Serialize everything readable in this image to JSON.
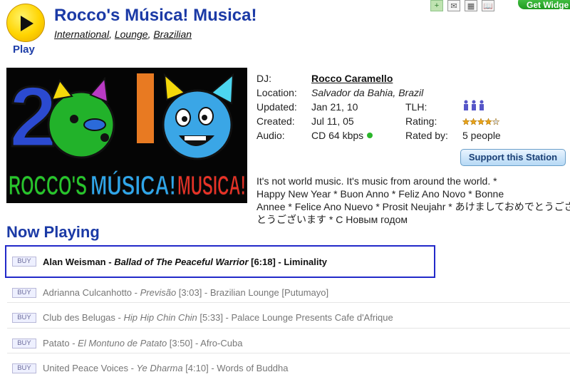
{
  "play": {
    "label": "Play"
  },
  "header": {
    "title": "Rocco's Música! Musica!",
    "genres": [
      "International",
      "Lounge",
      "Brazilian"
    ]
  },
  "toolbar": {
    "get_widget": "Get Widge"
  },
  "artwork": {
    "year_text": "2010",
    "caption_parts": [
      "ROCCO'S",
      "MÚSICA!",
      "MUSICA!"
    ]
  },
  "info": {
    "dj_label": "DJ:",
    "dj": "Rocco Caramello",
    "location_label": "Location:",
    "location": "Salvador da Bahia, Brazil",
    "updated_label": "Updated:",
    "updated": "Jan 21, 10",
    "tlh_label": "TLH:",
    "created_label": "Created:",
    "created": "Jul 11, 05",
    "rating_label": "Rating:",
    "rating": 4,
    "audio_label": "Audio:",
    "audio": "CD 64 kbps",
    "rated_by_label": "Rated by:",
    "rated_by": "5 people"
  },
  "support_button": "Support this Station",
  "description": [
    "It's not world music. It's music from around the world. *",
    "Happy New Year * Buon Anno * Feliz Ano Novo * Bonne",
    "Annee * Felice Ano Nuevo * Prosit Neujahr * あけましておめでとうございます",
    "とうございます * С Новым годом"
  ],
  "now_playing_heading": "Now Playing",
  "tracks": [
    {
      "buy": "BUY",
      "artist": "Alan Weisman",
      "sep1": " - ",
      "song": "Ballad of The Peaceful Warrior",
      "duration": " [6:18]",
      "sep2": " - ",
      "album": "Liminality"
    },
    {
      "buy": "BUY",
      "artist": "Adrianna Culcanhotto",
      "sep1": " - ",
      "song": "Previsão",
      "duration": " [3:03]",
      "sep2": " - ",
      "album": "Brazilian Lounge [Putumayo]"
    },
    {
      "buy": "BUY",
      "artist": "Club des Belugas",
      "sep1": " - ",
      "song": "Hip Hip Chin Chin",
      "duration": " [5:33]",
      "sep2": " - ",
      "album": "Palace Lounge Presents Cafe d'Afrique"
    },
    {
      "buy": "BUY",
      "artist": "Patato",
      "sep1": " - ",
      "song": "El Montuno de Patato",
      "duration": " [3:50]",
      "sep2": " - ",
      "album": "Afro-Cuba"
    },
    {
      "buy": "BUY",
      "artist": "United Peace Voices",
      "sep1": " - ",
      "song": "Ye Dharma",
      "duration": " [4:10]",
      "sep2": " - ",
      "album": "Words of Buddha"
    }
  ]
}
